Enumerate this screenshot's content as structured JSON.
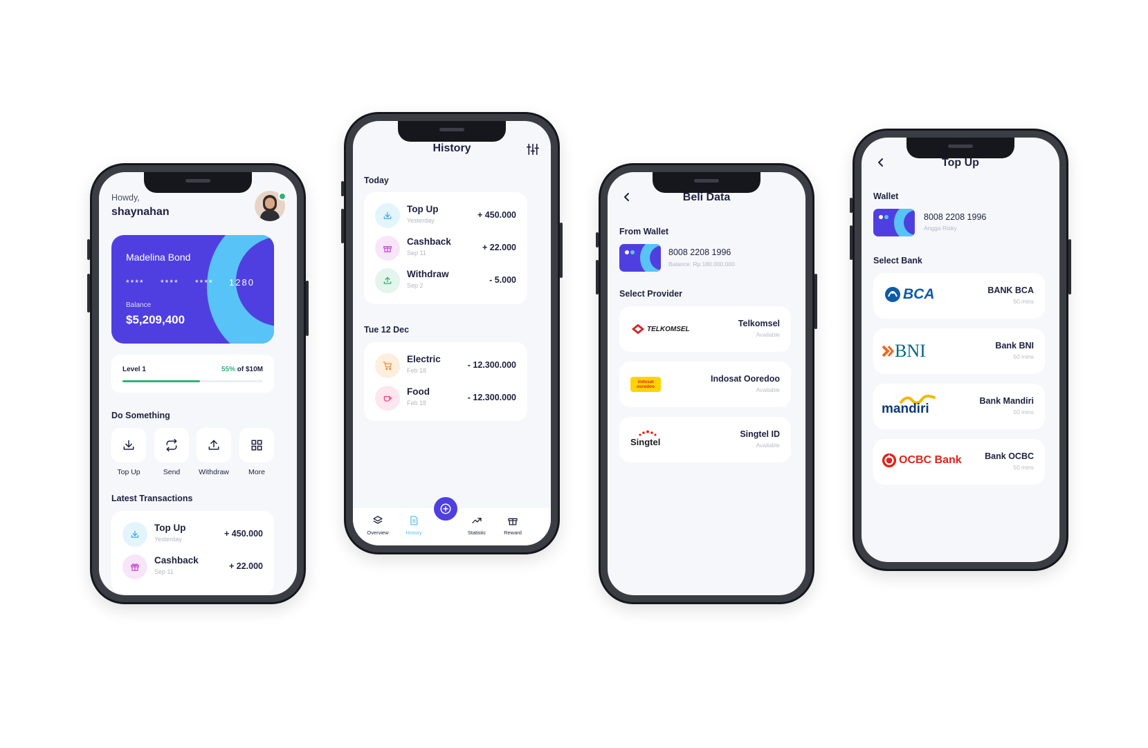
{
  "colors": {
    "primary": "#4f3fe0",
    "accent": "#58c3f7",
    "green": "#2fb27b",
    "dark": "#1d2140"
  },
  "home": {
    "greeting": "Howdy,",
    "username": "shaynahan",
    "card": {
      "holder": "Madelina Bond",
      "masked_groups": [
        "****",
        "****",
        "****"
      ],
      "last4": "1280",
      "balance_label": "Balance",
      "balance": "$5,209,400"
    },
    "level": {
      "label": "Level 1",
      "percent_text": "55%",
      "of_text": "of $10M",
      "progress": 0.55
    },
    "do_something_title": "Do Something",
    "actions": [
      {
        "label": "Top Up",
        "icon": "download-icon"
      },
      {
        "label": "Send",
        "icon": "repeat-icon"
      },
      {
        "label": "Withdraw",
        "icon": "upload-icon"
      },
      {
        "label": "More",
        "icon": "grid-icon"
      }
    ],
    "latest_title": "Latest Transactions",
    "transactions": [
      {
        "title": "Top Up",
        "sub": "Yesterday",
        "amount": "+ 450.000",
        "icon": "download-icon"
      },
      {
        "title": "Cashback",
        "sub": "Sep 11",
        "amount": "+ 22.000",
        "icon": "gift-icon"
      }
    ]
  },
  "history": {
    "title": "History",
    "groups": [
      {
        "label": "Today",
        "items": [
          {
            "title": "Top Up",
            "sub": "Yesterday",
            "amount": "+ 450.000",
            "icon": "download-icon"
          },
          {
            "title": "Cashback",
            "sub": "Sep 11",
            "amount": "+ 22.000",
            "icon": "gift-icon"
          },
          {
            "title": "Withdraw",
            "sub": "Sep 2",
            "amount": "- 5.000",
            "icon": "upload-icon"
          }
        ]
      },
      {
        "label": "Tue 12 Dec",
        "items": [
          {
            "title": "Electric",
            "sub": "Feb 18",
            "amount": "- 12.300.000",
            "icon": "cart-icon"
          },
          {
            "title": "Food",
            "sub": "Feb 18",
            "amount": "- 12.300.000",
            "icon": "cup-icon"
          }
        ]
      }
    ],
    "nav": [
      {
        "label": "Overview",
        "icon": "layers-icon",
        "active": false
      },
      {
        "label": "History",
        "icon": "document-icon",
        "active": true
      },
      {
        "label": "Statistic",
        "icon": "trending-icon",
        "active": false
      },
      {
        "label": "Reward",
        "icon": "gift-icon",
        "active": false
      }
    ]
  },
  "beli_data": {
    "title": "Beli Data",
    "from_wallet_label": "From Wallet",
    "wallet_number": "8008 2208 1996",
    "wallet_balance": "Balance: Rp 180.000.000",
    "select_provider_label": "Select Provider",
    "providers": [
      {
        "name": "Telkomsel",
        "status": "Available",
        "logo": "TELKOMSEL"
      },
      {
        "name": "Indosat Ooredoo",
        "status": "Available",
        "logo": "indosat ooredoo"
      },
      {
        "name": "Singtel ID",
        "status": "Available",
        "logo": "Singtel"
      }
    ]
  },
  "topup": {
    "title": "Top Up",
    "wallet_label": "Wallet",
    "wallet_number": "8008 2208 1996",
    "wallet_owner": "Angga Risky",
    "select_bank_label": "Select Bank",
    "banks": [
      {
        "name": "BANK BCA",
        "time": "50 mins",
        "logo": "BCA"
      },
      {
        "name": "Bank BNI",
        "time": "50 mins",
        "logo": "BNI"
      },
      {
        "name": "Bank Mandiri",
        "time": "50 mins",
        "logo": "mandiri"
      },
      {
        "name": "Bank OCBC",
        "time": "50 mins",
        "logo": "OCBC Bank"
      }
    ]
  }
}
